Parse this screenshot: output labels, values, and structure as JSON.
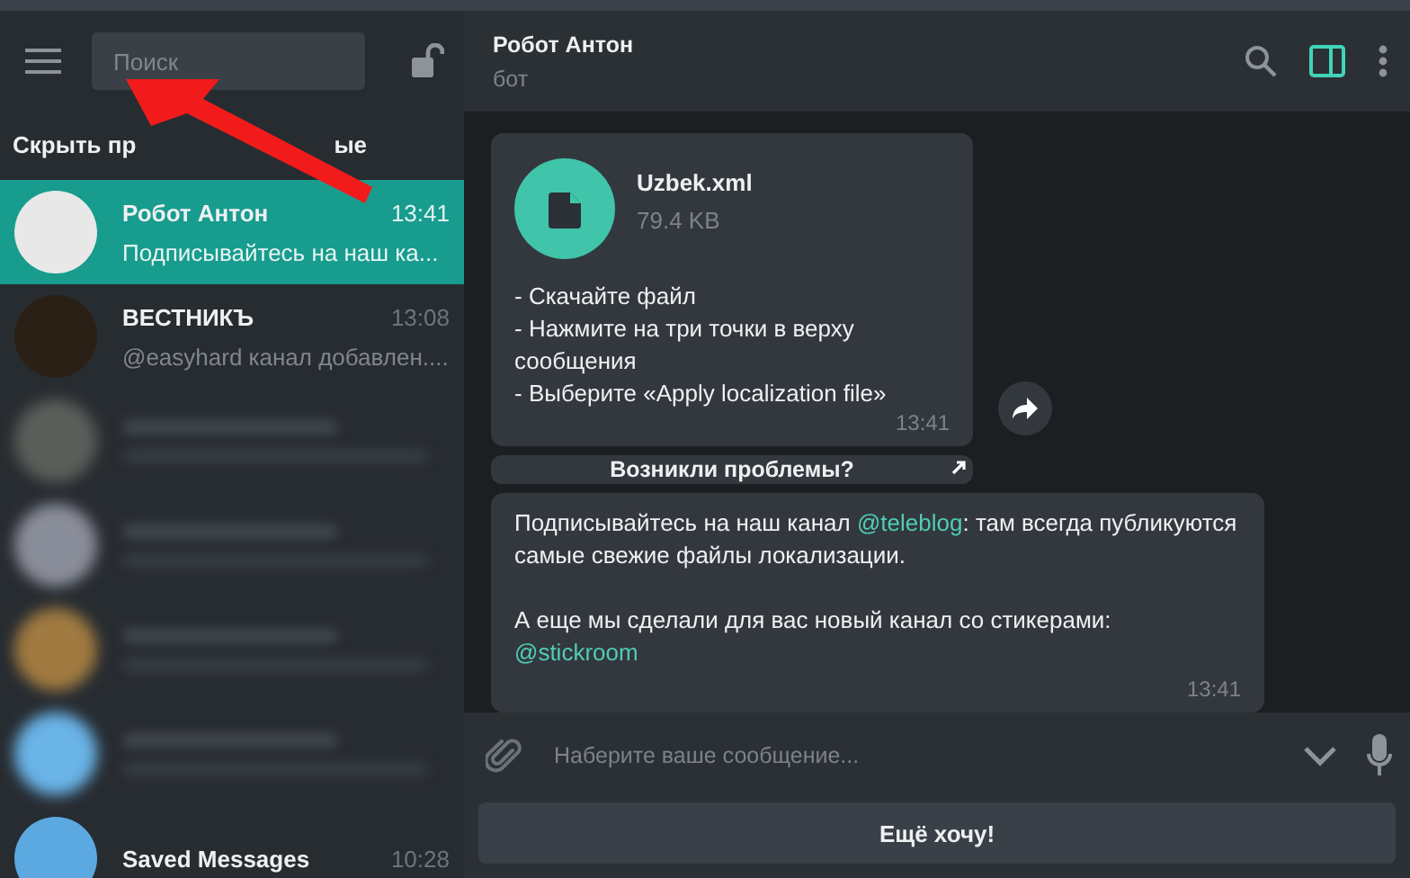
{
  "sidebar": {
    "search": {
      "placeholder": "Поиск"
    },
    "section_label": [
      "Скрыть пр",
      "ые"
    ],
    "chats": [
      {
        "kind": "chat",
        "name": "Робот Антон",
        "time": "13:41",
        "preview": "Подписывайтесь на наш ка...",
        "selected": true,
        "color": "#e8e8e8"
      },
      {
        "kind": "chat",
        "name": "ВЕСТНИКЪ",
        "time": "13:08",
        "preview": "@easyhard канал добавлен....",
        "selected": false,
        "color": "#2a2016"
      },
      {
        "kind": "blurred",
        "selected": false,
        "color": "#5a5f5a"
      },
      {
        "kind": "blurred",
        "selected": false,
        "color": "#8a8e9a"
      },
      {
        "kind": "blurred",
        "selected": false,
        "color": "#a07a40"
      },
      {
        "kind": "blurred",
        "selected": false,
        "color": "#6ab4e8"
      },
      {
        "kind": "chat",
        "name": "Saved Messages",
        "time": "10:28",
        "selected": false,
        "color": "#5ca8e0"
      }
    ]
  },
  "chat": {
    "title": "Робот Антон",
    "subtitle": "бот",
    "side_panel_on": true,
    "messages": [
      {
        "kind": "file",
        "file_name": "Uzbek.xml",
        "file_size": "79.4 KB",
        "lines": [
          "- Скачайте файл",
          "- Нажмите на три точки в верху сообщения",
          "- Выберите «Apply localization file»"
        ],
        "time": "13:41"
      },
      {
        "kind": "inline_button",
        "label": "Возникли проблемы?"
      },
      {
        "kind": "text",
        "paragraphs": [
          [
            {
              "text": "Подписывайтесь на наш канал "
            },
            {
              "text": "@teleblog",
              "link": true
            },
            {
              "text": ": там всегда публикуются самые свежие файлы локализации."
            }
          ],
          [
            {
              "text": "А еще мы сделали для вас новый канал со стикерами: "
            },
            {
              "text": "@stickroom",
              "link": true
            }
          ]
        ],
        "time": "13:41"
      }
    ],
    "composer": {
      "placeholder": "Наберите ваше сообщение..."
    },
    "bot_button": "Ещё хочу!"
  }
}
